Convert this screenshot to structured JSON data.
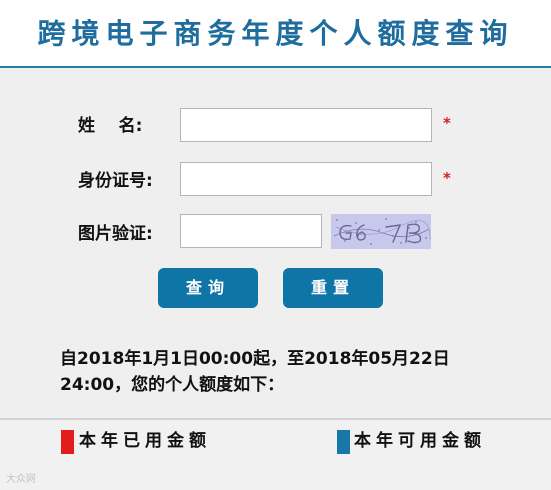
{
  "header": {
    "title": "跨境电子商务年度个人额度查询"
  },
  "form": {
    "name_label": "姓    名:",
    "id_label": "身份证号:",
    "captcha_label": "图片验证:",
    "required_mark": "*",
    "name_value": "",
    "id_value": "",
    "captcha_value": ""
  },
  "buttons": {
    "query": "查询",
    "reset": "重置"
  },
  "info": {
    "line1": "自2018年1月1日00:00起，至2018年05月22日",
    "line2": "24:00，您的个人额度如下："
  },
  "legend": {
    "used": "本年已用金额",
    "available": "本年可用金额",
    "used_color": "#e21d1d",
    "available_color": "#1a78a8"
  },
  "watermark": "大众网"
}
